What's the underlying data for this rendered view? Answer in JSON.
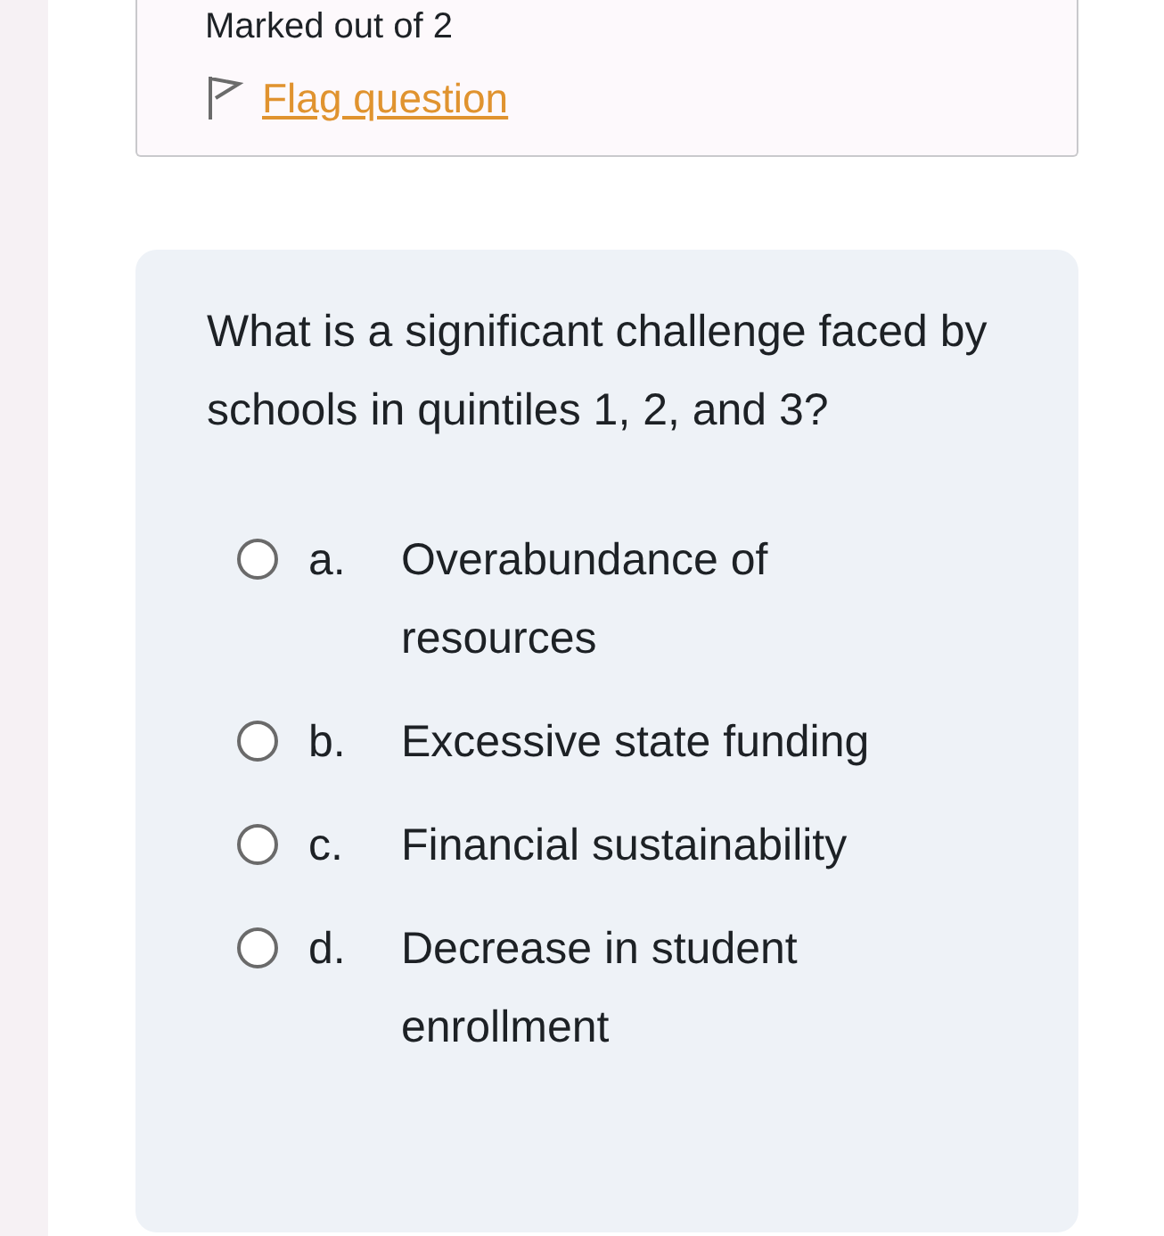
{
  "info": {
    "marks": "Marked out of 2",
    "flag_link": "Flag question"
  },
  "question": {
    "text": "What is a significant challenge faced by schools in quintiles 1, 2, and 3?",
    "options": [
      {
        "letter": "a.",
        "text": "Overabundance of resources",
        "selected": false
      },
      {
        "letter": "b.",
        "text": "Excessive state funding",
        "selected": false
      },
      {
        "letter": "c.",
        "text": "Financial sustainability",
        "selected": false
      },
      {
        "letter": "d.",
        "text": "Decrease in student enrollment",
        "selected": false
      }
    ]
  }
}
